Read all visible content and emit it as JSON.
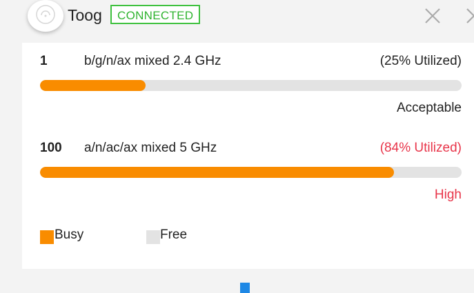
{
  "header": {
    "device_name": "Toog",
    "status": "CONNECTED",
    "icon": "access-point-icon"
  },
  "radios": [
    {
      "channel": "1",
      "mode": "b/g/n/ax mixed  2.4 GHz",
      "utilization_text": "(25% Utilized)",
      "utilization_fraction": 0.25,
      "level": "Acceptable",
      "status_color": "#222222"
    },
    {
      "channel": "100",
      "mode": "a/n/ac/ax mixed  5 GHz",
      "utilization_text": "(84% Utilized)",
      "utilization_fraction": 0.84,
      "level": "High",
      "status_color": "#e8354a"
    }
  ],
  "legend": {
    "busy_label": "Busy",
    "free_label": "Free",
    "busy_color": "#f98c00",
    "free_color": "#e3e3e3"
  },
  "colors": {
    "accent": "#f98c00",
    "connected": "#2fb32f",
    "high": "#e8354a"
  }
}
